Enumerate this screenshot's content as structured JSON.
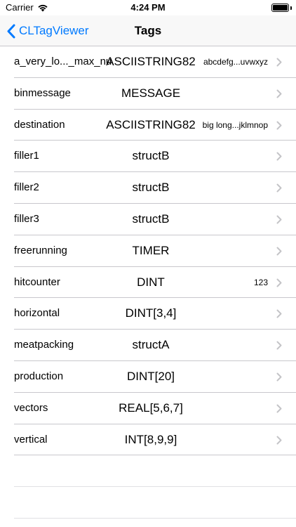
{
  "status_bar": {
    "carrier": "Carrier",
    "time": "4:24 PM",
    "battery_level": 1.0
  },
  "nav": {
    "back_label": "CLTagViewer",
    "title": "Tags",
    "accent_color": "#007aff"
  },
  "tags": [
    {
      "name": "a_very_lo..._max_nu",
      "type": "ASCIISTRING82",
      "value": "abcdefg...uvwxyz"
    },
    {
      "name": "binmessage",
      "type": "MESSAGE",
      "value": ""
    },
    {
      "name": "destination",
      "type": "ASCIISTRING82",
      "value": "big long...jklmnop"
    },
    {
      "name": "filler1",
      "type": "structB",
      "value": ""
    },
    {
      "name": "filler2",
      "type": "structB",
      "value": ""
    },
    {
      "name": "filler3",
      "type": "structB",
      "value": ""
    },
    {
      "name": "freerunning",
      "type": "TIMER",
      "value": ""
    },
    {
      "name": "hitcounter",
      "type": "DINT",
      "value": "123"
    },
    {
      "name": "horizontal",
      "type": "DINT[3,4]",
      "value": ""
    },
    {
      "name": "meatpacking",
      "type": "structA",
      "value": ""
    },
    {
      "name": "production",
      "type": "DINT[20]",
      "value": ""
    },
    {
      "name": "vectors",
      "type": "REAL[5,6,7]",
      "value": ""
    },
    {
      "name": "vertical",
      "type": "INT[8,9,9]",
      "value": ""
    }
  ]
}
